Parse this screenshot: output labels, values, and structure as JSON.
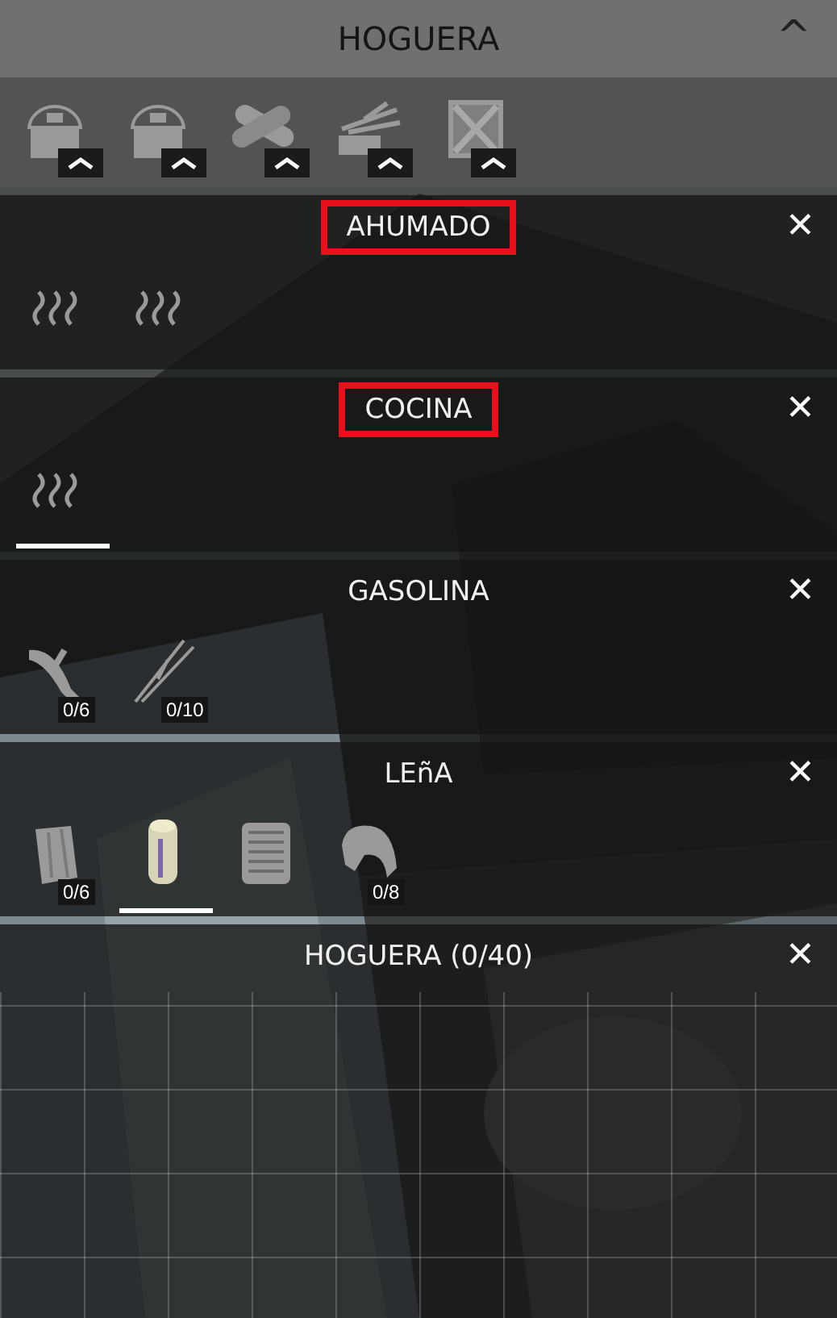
{
  "header": {
    "title": "HOGUERA",
    "caret": "^"
  },
  "toolbar": [
    {
      "kind": "pot"
    },
    {
      "kind": "pot"
    },
    {
      "kind": "logs"
    },
    {
      "kind": "sticks"
    },
    {
      "kind": "crate"
    }
  ],
  "sections": [
    {
      "kind": "list",
      "title": "AHUMADO",
      "highlighted": true,
      "close": "✕",
      "items": [
        {
          "kind": "steam",
          "selected": false
        },
        {
          "kind": "steam",
          "selected": false
        }
      ]
    },
    {
      "kind": "list",
      "title": "COCINA",
      "highlighted": true,
      "close": "✕",
      "items": [
        {
          "kind": "steam",
          "selected": true
        }
      ]
    },
    {
      "kind": "list",
      "title": "GASOLINA",
      "highlighted": false,
      "close": "✕",
      "items": [
        {
          "kind": "branch",
          "selected": false,
          "count": "0/6"
        },
        {
          "kind": "twigs",
          "selected": false,
          "count": "0/10"
        }
      ]
    },
    {
      "kind": "list",
      "title": "LEñA",
      "highlighted": false,
      "close": "✕",
      "items": [
        {
          "kind": "bark",
          "selected": false,
          "count": "0/6"
        },
        {
          "kind": "canister",
          "selected": true
        },
        {
          "kind": "paper",
          "selected": false
        },
        {
          "kind": "roll",
          "selected": false,
          "count": "0/8"
        }
      ]
    },
    {
      "kind": "grid",
      "title": "HOGUERA (0/40)",
      "highlighted": false,
      "close": "✕"
    }
  ]
}
